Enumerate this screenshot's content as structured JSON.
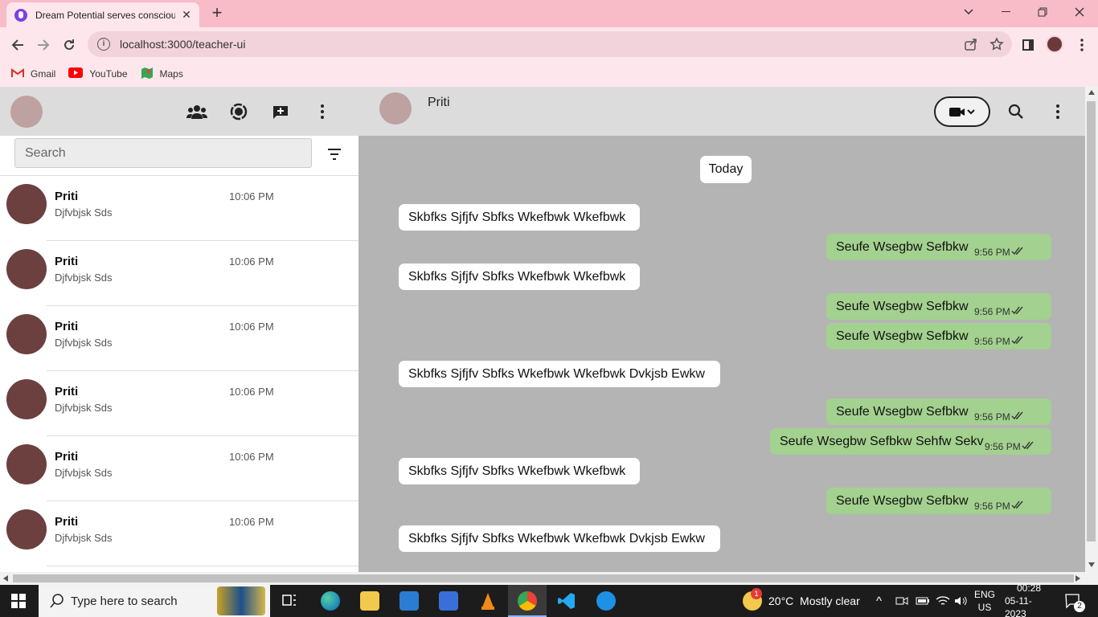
{
  "browser": {
    "tab_title": "Dream Potential serves consciou",
    "url": "localhost:3000/teacher-ui",
    "bookmarks": [
      {
        "label": "Gmail",
        "icon": "gmail-icon"
      },
      {
        "label": "YouTube",
        "icon": "youtube-icon"
      },
      {
        "label": "Maps",
        "icon": "maps-icon"
      }
    ]
  },
  "sidebar": {
    "search_placeholder": "Search",
    "chats": [
      {
        "name": "Priti",
        "message": "Djfvbjsk Sds",
        "time": "10:06 PM"
      },
      {
        "name": "Priti",
        "message": "Djfvbjsk Sds",
        "time": "10:06 PM"
      },
      {
        "name": "Priti",
        "message": "Djfvbjsk Sds",
        "time": "10:06 PM"
      },
      {
        "name": "Priti",
        "message": "Djfvbjsk Sds",
        "time": "10:06 PM"
      },
      {
        "name": "Priti",
        "message": "Djfvbjsk Sds",
        "time": "10:06 PM"
      },
      {
        "name": "Priti",
        "message": "Djfvbjsk Sds",
        "time": "10:06 PM"
      }
    ]
  },
  "conversation": {
    "contact_name": "Priti",
    "day_label": "Today",
    "messages": [
      {
        "dir": "in",
        "text": "Skbfks Sjfjfv Sbfks Wkefbwk Wkefbwk"
      },
      {
        "dir": "out",
        "text": "Seufe Wsegbw Sefbkw",
        "time": "9:56 PM"
      },
      {
        "dir": "in",
        "text": "Skbfks Sjfjfv Sbfks Wkefbwk Wkefbwk"
      },
      {
        "dir": "out",
        "text": "Seufe Wsegbw Sefbkw",
        "time": "9:56 PM"
      },
      {
        "dir": "out",
        "text": "Seufe Wsegbw Sefbkw",
        "time": "9:56 PM"
      },
      {
        "dir": "in",
        "text": "Skbfks Sjfjfv Sbfks Wkefbwk Wkefbwk Dvkjsb Ewkw"
      },
      {
        "dir": "out",
        "text": "Seufe Wsegbw Sefbkw",
        "time": "9:56 PM"
      },
      {
        "dir": "out",
        "text": "Seufe Wsegbw Sefbkw Sehfw Sekv",
        "time": "9:56 PM"
      },
      {
        "dir": "in",
        "text": "Skbfks Sjfjfv Sbfks Wkefbwk Wkefbwk"
      },
      {
        "dir": "out",
        "text": "Seufe Wsegbw Sefbkw",
        "time": "9:56 PM"
      },
      {
        "dir": "in",
        "text": "Skbfks Sjfjfv Sbfks Wkefbwk Wkefbwk Dvkjsb Ewkw"
      }
    ]
  },
  "taskbar": {
    "search_placeholder": "Type here to search",
    "weather": "20°C  Mostly clear",
    "weather_badge": "1",
    "language": "ENG",
    "region": "US",
    "time": "00:28",
    "date": "05-11-2023",
    "notifications": "2"
  },
  "colors": {
    "chrome_tab_bar": "#f8bcc8",
    "chrome_toolbar": "#fde7ec",
    "incoming_bubble": "#ffffff",
    "outgoing_bubble": "#a3d18f",
    "chat_background": "#b4b4b4",
    "avatar": "#6b403e"
  }
}
